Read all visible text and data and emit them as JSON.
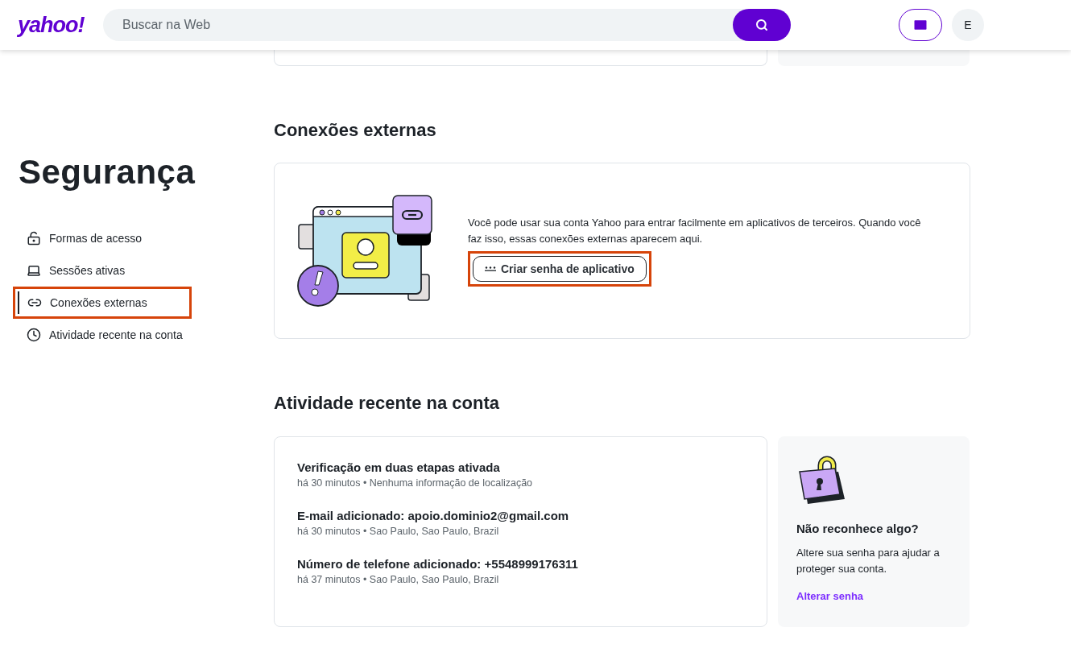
{
  "header": {
    "logo": "yahoo!",
    "search": {
      "placeholder": "Buscar na Web"
    },
    "avatar": "E"
  },
  "sidebar": {
    "title": "Segurança",
    "items": [
      {
        "kind": "lock",
        "label": "Formas de acesso",
        "selected": false,
        "highlighted": false
      },
      {
        "kind": "laptop",
        "label": "Sessões ativas",
        "selected": false,
        "highlighted": false
      },
      {
        "kind": "link",
        "label": "Conexões externas",
        "selected": true,
        "highlighted": true
      },
      {
        "kind": "clock",
        "label": "Atividade recente na conta",
        "selected": false,
        "highlighted": false
      }
    ]
  },
  "external_connections": {
    "title": "Conexões externas",
    "text": "Você pode usar sua conta Yahoo para entrar facilmente em aplicativos de terceiros. Quando você faz isso, essas conexões externas aparecem aqui.",
    "button": {
      "label": "Criar senha de aplicativo",
      "highlighted": true
    }
  },
  "recent_activity": {
    "title": "Atividade recente na conta",
    "events": [
      {
        "title": "Verificação em duas etapas ativada",
        "detail": "há 30 minutos • Nenhuma informação de localização"
      },
      {
        "title": "E-mail adicionado: apoio.dominio2@gmail.com",
        "detail": "há 30 minutos • Sao Paulo, Sao Paulo, Brazil"
      },
      {
        "title": "Número de telefone adicionado: +5548999176311",
        "detail": "há 37 minutos • Sao Paulo, Sao Paulo, Brazil"
      }
    ],
    "aside": {
      "title": "Não reconhece algo?",
      "text": "Altere sua senha para ajudar a proteger sua conta.",
      "link": "Alterar senha"
    }
  }
}
